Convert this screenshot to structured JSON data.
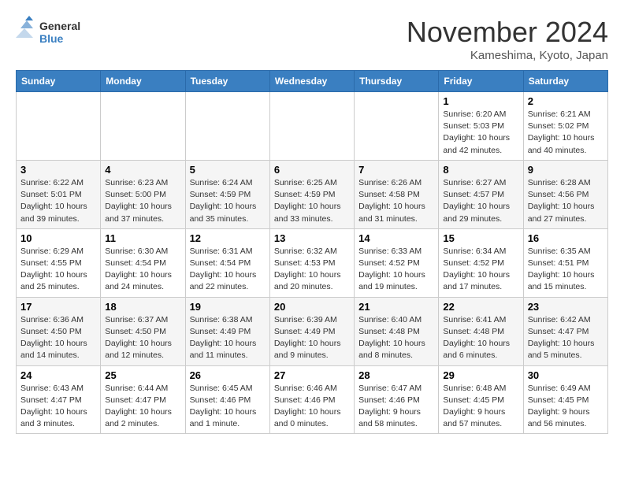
{
  "header": {
    "logo_line1": "General",
    "logo_line2": "Blue",
    "month": "November 2024",
    "location": "Kameshima, Kyoto, Japan"
  },
  "weekdays": [
    "Sunday",
    "Monday",
    "Tuesday",
    "Wednesday",
    "Thursday",
    "Friday",
    "Saturday"
  ],
  "weeks": [
    [
      {
        "day": "",
        "info": ""
      },
      {
        "day": "",
        "info": ""
      },
      {
        "day": "",
        "info": ""
      },
      {
        "day": "",
        "info": ""
      },
      {
        "day": "",
        "info": ""
      },
      {
        "day": "1",
        "info": "Sunrise: 6:20 AM\nSunset: 5:03 PM\nDaylight: 10 hours and 42 minutes."
      },
      {
        "day": "2",
        "info": "Sunrise: 6:21 AM\nSunset: 5:02 PM\nDaylight: 10 hours and 40 minutes."
      }
    ],
    [
      {
        "day": "3",
        "info": "Sunrise: 6:22 AM\nSunset: 5:01 PM\nDaylight: 10 hours and 39 minutes."
      },
      {
        "day": "4",
        "info": "Sunrise: 6:23 AM\nSunset: 5:00 PM\nDaylight: 10 hours and 37 minutes."
      },
      {
        "day": "5",
        "info": "Sunrise: 6:24 AM\nSunset: 4:59 PM\nDaylight: 10 hours and 35 minutes."
      },
      {
        "day": "6",
        "info": "Sunrise: 6:25 AM\nSunset: 4:59 PM\nDaylight: 10 hours and 33 minutes."
      },
      {
        "day": "7",
        "info": "Sunrise: 6:26 AM\nSunset: 4:58 PM\nDaylight: 10 hours and 31 minutes."
      },
      {
        "day": "8",
        "info": "Sunrise: 6:27 AM\nSunset: 4:57 PM\nDaylight: 10 hours and 29 minutes."
      },
      {
        "day": "9",
        "info": "Sunrise: 6:28 AM\nSunset: 4:56 PM\nDaylight: 10 hours and 27 minutes."
      }
    ],
    [
      {
        "day": "10",
        "info": "Sunrise: 6:29 AM\nSunset: 4:55 PM\nDaylight: 10 hours and 25 minutes."
      },
      {
        "day": "11",
        "info": "Sunrise: 6:30 AM\nSunset: 4:54 PM\nDaylight: 10 hours and 24 minutes."
      },
      {
        "day": "12",
        "info": "Sunrise: 6:31 AM\nSunset: 4:54 PM\nDaylight: 10 hours and 22 minutes."
      },
      {
        "day": "13",
        "info": "Sunrise: 6:32 AM\nSunset: 4:53 PM\nDaylight: 10 hours and 20 minutes."
      },
      {
        "day": "14",
        "info": "Sunrise: 6:33 AM\nSunset: 4:52 PM\nDaylight: 10 hours and 19 minutes."
      },
      {
        "day": "15",
        "info": "Sunrise: 6:34 AM\nSunset: 4:52 PM\nDaylight: 10 hours and 17 minutes."
      },
      {
        "day": "16",
        "info": "Sunrise: 6:35 AM\nSunset: 4:51 PM\nDaylight: 10 hours and 15 minutes."
      }
    ],
    [
      {
        "day": "17",
        "info": "Sunrise: 6:36 AM\nSunset: 4:50 PM\nDaylight: 10 hours and 14 minutes."
      },
      {
        "day": "18",
        "info": "Sunrise: 6:37 AM\nSunset: 4:50 PM\nDaylight: 10 hours and 12 minutes."
      },
      {
        "day": "19",
        "info": "Sunrise: 6:38 AM\nSunset: 4:49 PM\nDaylight: 10 hours and 11 minutes."
      },
      {
        "day": "20",
        "info": "Sunrise: 6:39 AM\nSunset: 4:49 PM\nDaylight: 10 hours and 9 minutes."
      },
      {
        "day": "21",
        "info": "Sunrise: 6:40 AM\nSunset: 4:48 PM\nDaylight: 10 hours and 8 minutes."
      },
      {
        "day": "22",
        "info": "Sunrise: 6:41 AM\nSunset: 4:48 PM\nDaylight: 10 hours and 6 minutes."
      },
      {
        "day": "23",
        "info": "Sunrise: 6:42 AM\nSunset: 4:47 PM\nDaylight: 10 hours and 5 minutes."
      }
    ],
    [
      {
        "day": "24",
        "info": "Sunrise: 6:43 AM\nSunset: 4:47 PM\nDaylight: 10 hours and 3 minutes."
      },
      {
        "day": "25",
        "info": "Sunrise: 6:44 AM\nSunset: 4:47 PM\nDaylight: 10 hours and 2 minutes."
      },
      {
        "day": "26",
        "info": "Sunrise: 6:45 AM\nSunset: 4:46 PM\nDaylight: 10 hours and 1 minute."
      },
      {
        "day": "27",
        "info": "Sunrise: 6:46 AM\nSunset: 4:46 PM\nDaylight: 10 hours and 0 minutes."
      },
      {
        "day": "28",
        "info": "Sunrise: 6:47 AM\nSunset: 4:46 PM\nDaylight: 9 hours and 58 minutes."
      },
      {
        "day": "29",
        "info": "Sunrise: 6:48 AM\nSunset: 4:45 PM\nDaylight: 9 hours and 57 minutes."
      },
      {
        "day": "30",
        "info": "Sunrise: 6:49 AM\nSunset: 4:45 PM\nDaylight: 9 hours and 56 minutes."
      }
    ]
  ]
}
